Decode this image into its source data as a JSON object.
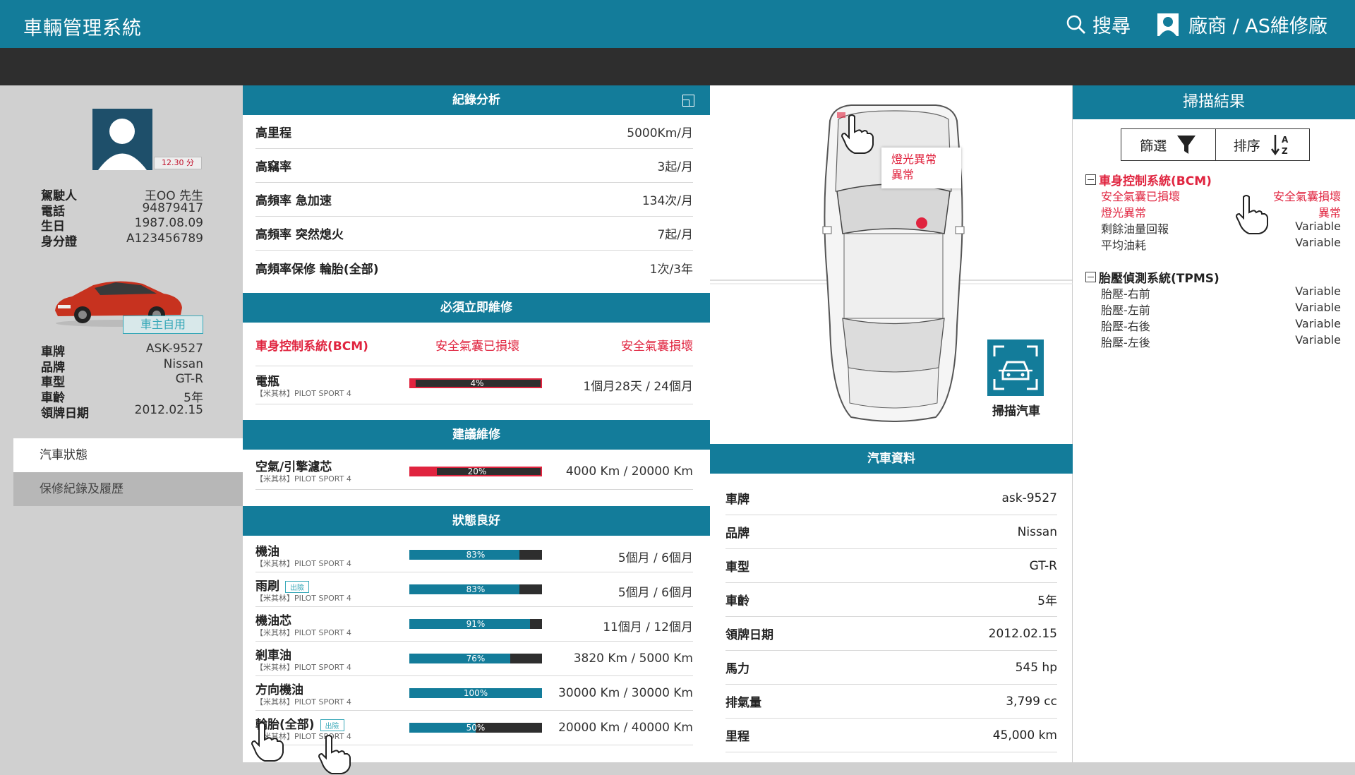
{
  "header": {
    "title": "車輛管理系統",
    "search_label": "搜尋",
    "user_label": "廠商 / AS維修廠"
  },
  "driver": {
    "score": "12.30 分",
    "fields": [
      {
        "k": "駕駛人",
        "v": "王OO 先生"
      },
      {
        "k": "電話",
        "v": "94879417"
      },
      {
        "k": "生日",
        "v": "1987.08.09"
      },
      {
        "k": "身分證",
        "v": "A123456789"
      }
    ],
    "owner_tag": "車主自用",
    "car_fields": [
      {
        "k": "車牌",
        "v": "ASK-9527"
      },
      {
        "k": "品牌",
        "v": "Nissan"
      },
      {
        "k": "車型",
        "v": "GT-R"
      },
      {
        "k": "車齡",
        "v": "5年"
      },
      {
        "k": "領牌日期",
        "v": "2012.02.15"
      }
    ]
  },
  "nav": {
    "item1": "汽車狀態",
    "item2": "保修紀錄及履歷"
  },
  "record": {
    "title": "紀錄分析",
    "rows": [
      {
        "k": "高里程",
        "v": "5000Km/月"
      },
      {
        "k": "高竊率",
        "v": "3起/月"
      },
      {
        "k": "高頻率 急加速",
        "v": "134次/月"
      },
      {
        "k": "高頻率 突然熄火",
        "v": "7起/月"
      },
      {
        "k": "高頻率保修 輪胎(全部)",
        "v": "1次/3年"
      }
    ]
  },
  "urgent": {
    "title": "必須立即維修",
    "alert": {
      "system": "車身控制系統(BCM)",
      "issue": "安全氣囊已損壞",
      "status": "安全氣囊損壞"
    },
    "battery": {
      "name": "電瓶",
      "sub": "【米其林】PILOT SPORT 4",
      "pct": "4%",
      "pct_value": 4,
      "value": "1個月28天 / 24個月"
    }
  },
  "suggest": {
    "title": "建議維修",
    "item": {
      "name": "空氣/引擎濾芯",
      "sub": "【米其林】PILOT SPORT 4",
      "pct": "20%",
      "pct_value": 20,
      "value": "4000 Km / 20000 Km"
    }
  },
  "good": {
    "title": "狀態良好",
    "items": [
      {
        "name": "機油",
        "sub": "【米其林】PILOT SPORT 4",
        "badge": "",
        "pct": "83%",
        "pct_value": 83,
        "value": "5個月 / 6個月"
      },
      {
        "name": "雨刷",
        "sub": "【米其林】PILOT SPORT 4",
        "badge": "出險",
        "pct": "83%",
        "pct_value": 83,
        "value": "5個月 / 6個月"
      },
      {
        "name": "機油芯",
        "sub": "【米其林】PILOT SPORT 4",
        "badge": "",
        "pct": "91%",
        "pct_value": 91,
        "value": "11個月 / 12個月"
      },
      {
        "name": "剎車油",
        "sub": "【米其林】PILOT SPORT 4",
        "badge": "",
        "pct": "76%",
        "pct_value": 76,
        "value": "3820 Km / 5000 Km"
      },
      {
        "name": "方向機油",
        "sub": "【米其林】PILOT SPORT 4",
        "badge": "",
        "pct": "100%",
        "pct_value": 100,
        "value": "30000 Km / 30000 Km"
      },
      {
        "name": "輪胎(全部)",
        "sub": "【米其林】PILOT SPORT 4",
        "badge": "出險",
        "pct": "50%",
        "pct_value": 50,
        "value": "20000 Km / 40000 Km"
      }
    ]
  },
  "diagram": {
    "balloon_line1": "燈光異常",
    "balloon_line2": "異常",
    "scan_label": "掃描汽車"
  },
  "carinfo": {
    "title": "汽車資料",
    "rows": [
      {
        "k": "車牌",
        "v": "ask-9527"
      },
      {
        "k": "品牌",
        "v": "Nissan"
      },
      {
        "k": "車型",
        "v": "GT-R"
      },
      {
        "k": "車齡",
        "v": "5年"
      },
      {
        "k": "領牌日期",
        "v": "2012.02.15"
      },
      {
        "k": "馬力",
        "v": "545 hp"
      },
      {
        "k": "排氣量",
        "v": "3,799 cc"
      },
      {
        "k": "里程",
        "v": "45,000 km"
      }
    ]
  },
  "scan": {
    "title": "掃描結果",
    "filter_label": "篩選",
    "sort_label": "排序",
    "groups": [
      {
        "title": "車身控制系統(BCM)",
        "rows": [
          {
            "k": "安全氣囊已損壞",
            "v": "安全氣囊損壞"
          },
          {
            "k": "燈光異常",
            "v": "異常"
          },
          {
            "k": "剩餘油量回報",
            "v": "Variable"
          },
          {
            "k": "平均油耗",
            "v": "Variable"
          }
        ]
      },
      {
        "title": "胎壓偵測系統(TPMS)",
        "rows": [
          {
            "k": "胎壓-右前",
            "v": "Variable"
          },
          {
            "k": "胎壓-左前",
            "v": "Variable"
          },
          {
            "k": "胎壓-右後",
            "v": "Variable"
          },
          {
            "k": "胎壓-左後",
            "v": "Variable"
          }
        ]
      }
    ]
  },
  "colors": {
    "primary": "#137c9a",
    "dark": "#2e2e2e",
    "alert": "#e0243f",
    "accent": "#37a8b8"
  }
}
